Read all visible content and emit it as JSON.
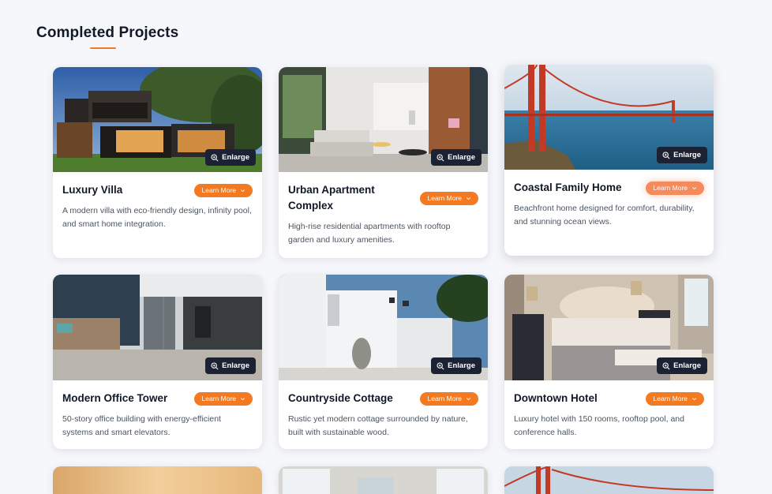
{
  "section": {
    "title": "Completed Projects"
  },
  "actions": {
    "enlarge_label": "Enlarge",
    "learn_more_label": "Learn More"
  },
  "colors": {
    "accent": "#f47a22",
    "enlarge_bg": "#1b2233",
    "page_bg": "#f6f7fb"
  },
  "projects": [
    {
      "title": "Luxury Villa",
      "description": "A modern villa with eco-friendly design, infinity pool, and smart home integration.",
      "image": "modern-villa-photo"
    },
    {
      "title": "Urban Apartment Complex",
      "description": "High-rise residential apartments with rooftop garden and luxury amenities.",
      "image": "apartment-interior-photo"
    },
    {
      "title": "Coastal Family Home",
      "description": "Beachfront home designed for comfort, durability, and stunning ocean views.",
      "image": "golden-gate-bridge-photo"
    },
    {
      "title": "Modern Office Tower",
      "description": "50-story office building with energy-efficient systems and smart elevators.",
      "image": "office-interior-photo"
    },
    {
      "title": "Countryside Cottage",
      "description": "Rustic yet modern cottage surrounded by nature, built with sustainable wood.",
      "image": "white-cottage-photo"
    },
    {
      "title": "Downtown Hotel",
      "description": "Luxury hotel with 150 rooms, rooftop pool, and conference halls.",
      "image": "hotel-bedroom-photo"
    }
  ]
}
